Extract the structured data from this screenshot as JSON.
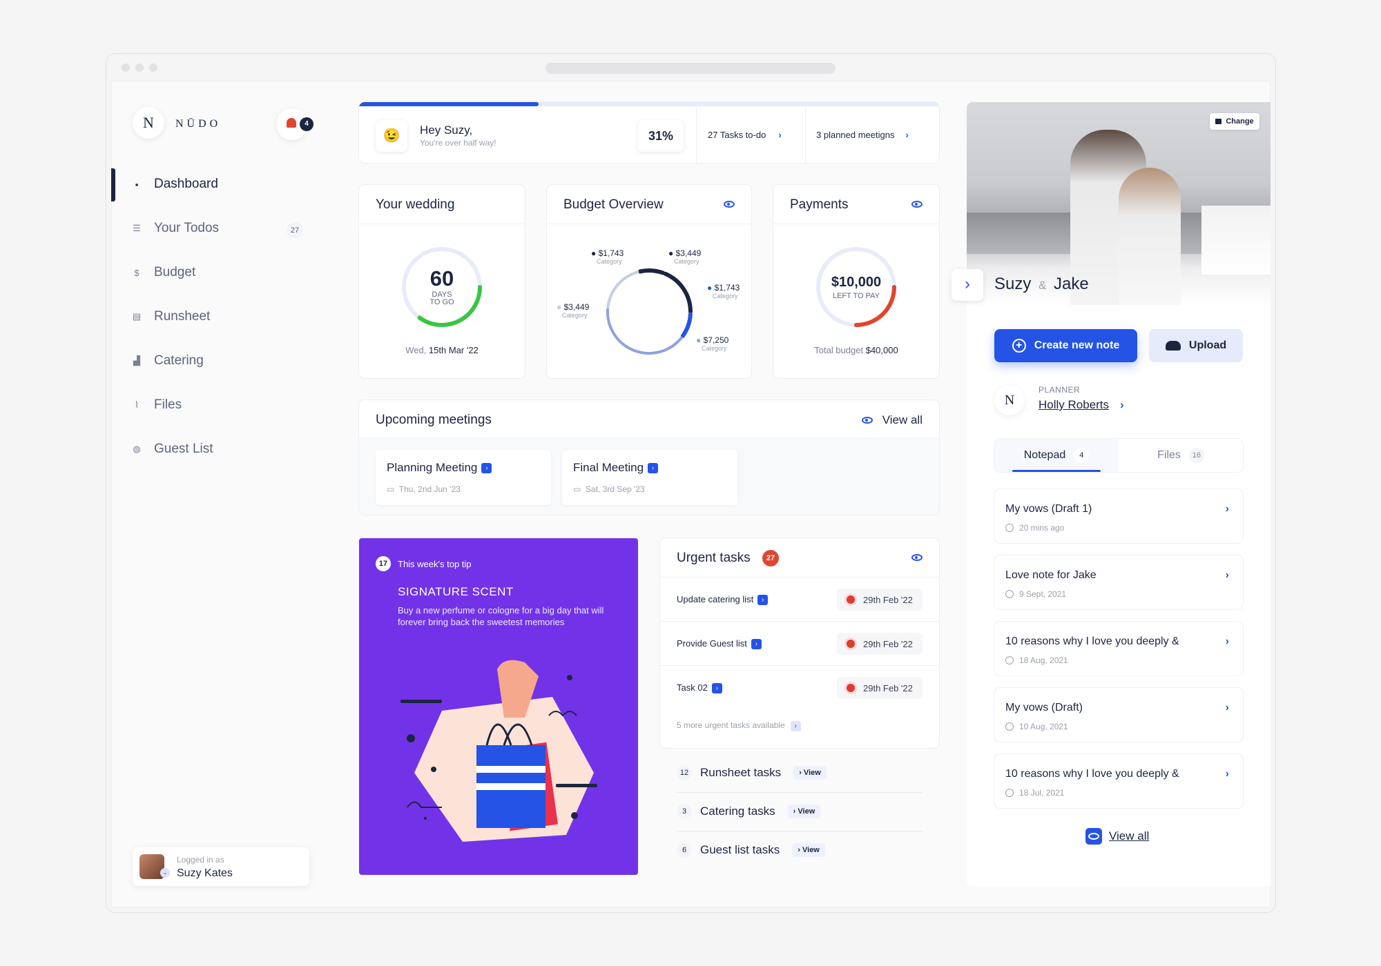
{
  "brand": {
    "name": "NŪDO",
    "logo_letter": "N"
  },
  "notifications": {
    "count": "4"
  },
  "sidebar": {
    "items": [
      {
        "label": "Dashboard",
        "icon": "grid-icon"
      },
      {
        "label": "Your Todos",
        "icon": "list-icon",
        "badge": "27"
      },
      {
        "label": "Budget",
        "icon": "dollar-icon"
      },
      {
        "label": "Runsheet",
        "icon": "sheet-icon"
      },
      {
        "label": "Catering",
        "icon": "catering-icon"
      },
      {
        "label": "Files",
        "icon": "paperclip-icon"
      },
      {
        "label": "Guest List",
        "icon": "globe-icon"
      }
    ]
  },
  "user": {
    "logged_in_label": "Logged in as",
    "name": "Suzy Kates"
  },
  "greeting": {
    "title": "Hey Suzy,",
    "subtitle": "You're over half way!",
    "progress_percent": 31,
    "percent_label": "31%",
    "tasks_label": "27 Tasks to-do",
    "meetings_label": "3 planned meetigns"
  },
  "wedding": {
    "title": "Your wedding",
    "days": "60",
    "days_label": "DAYS",
    "to_go": "TO GO",
    "date_prefix": "Wed, ",
    "date": "15th Mar '22",
    "progress_fraction": 0.35
  },
  "budget": {
    "title": "Budget Overview"
  },
  "chart_data": {
    "type": "pie",
    "values": [
      1743,
      3449,
      1743,
      7250,
      3449
    ],
    "labels": [
      "$1,743",
      "$3,449",
      "$1,743",
      "$7,250",
      "$3,449"
    ],
    "sublabel": "Category"
  },
  "payments": {
    "title": "Payments",
    "amount": "$10,000",
    "left_label": "LEFT TO PAY",
    "total_prefix": "Total budget ",
    "total": "$40,000",
    "paid_fraction": 0.25
  },
  "meetings": {
    "title": "Upcoming meetings",
    "view_all": "View all",
    "items": [
      {
        "title": "Planning Meeting",
        "date": "Thu, 2nd Jun '23"
      },
      {
        "title": "Final Meeting",
        "date": "Sat, 3rd Sep '23"
      }
    ]
  },
  "tip": {
    "badge": "17",
    "header": "This week's top tip",
    "title": "SIGNATURE SCENT",
    "body": "Buy a new perfume or cologne for a big day that will forever bring back the sweetest memories"
  },
  "urgent": {
    "title": "Urgent tasks",
    "count": "27",
    "items": [
      {
        "label": "Update catering list",
        "date": "29th Feb '22"
      },
      {
        "label": "Provide Guest list",
        "date": "29th Feb '22"
      },
      {
        "label": "Task 02",
        "date": "29th Feb '22"
      }
    ],
    "more": "5 more urgent tasks available"
  },
  "categories": [
    {
      "count": "12",
      "label": "Runsheet tasks",
      "view": "View"
    },
    {
      "count": "3",
      "label": "Catering tasks",
      "view": "View"
    },
    {
      "count": "6",
      "label": "Guest list tasks",
      "view": "View"
    }
  ],
  "couple": {
    "name1": "Suzy",
    "amp": "&",
    "name2": "Jake",
    "change_label": "Change"
  },
  "actions": {
    "create_note": "Create new note",
    "upload": "Upload"
  },
  "planner": {
    "role": "PLANNER",
    "name": "Holly Roberts"
  },
  "notes_tabs": {
    "notepad": "Notepad",
    "notepad_count": "4",
    "files": "Files",
    "files_count": "16"
  },
  "notes": [
    {
      "title": "My vows (Draft 1)",
      "date": "20 mins ago"
    },
    {
      "title": "Love note for Jake",
      "date": "9 Sept, 2021"
    },
    {
      "title": "10 reasons why I love you deeply &",
      "date": "18 Aug, 2021"
    },
    {
      "title": "My vows (Draft)",
      "date": "10 Aug, 2021"
    },
    {
      "title": "10 reasons why I love you deeply &",
      "date": "18 Jul, 2021"
    }
  ],
  "notes_view_all": "View all",
  "colors": {
    "primary": "#2453e6",
    "green": "#37c741",
    "red": "#e0452f",
    "purple": "#7233e8",
    "navy": "#1b2540"
  }
}
